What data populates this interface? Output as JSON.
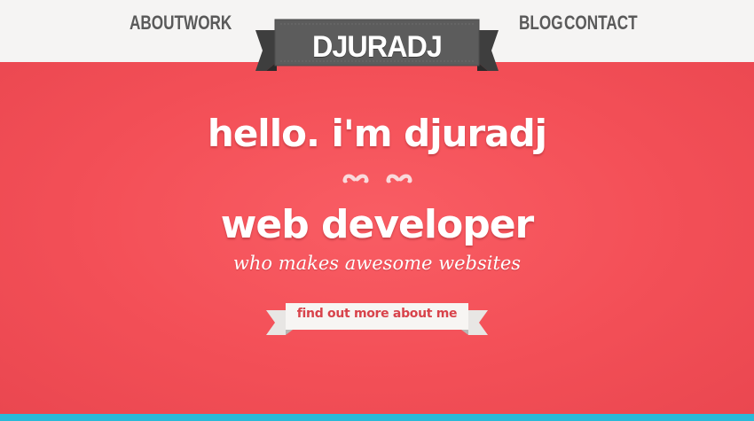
{
  "nav": {
    "about": "ABOUT",
    "work": "WORK",
    "blog": "BLOG",
    "contact": "CONTACT"
  },
  "logo": {
    "text": "DJURADJ"
  },
  "hero": {
    "title": "hello. i'm djuradj",
    "subtitle": "web developer",
    "tagline": "who makes awesome websites",
    "cta_label": "find out more about me"
  },
  "icons": {
    "divider": "mustache-icon"
  },
  "colors": {
    "hero_red": "#f34f57",
    "header_bg": "#f5f4f3",
    "nav_text": "#5a5a5a",
    "ribbon": "#5c5c5c",
    "cta_text": "#d8434b",
    "bottom_bar": "#2ab9d8"
  }
}
